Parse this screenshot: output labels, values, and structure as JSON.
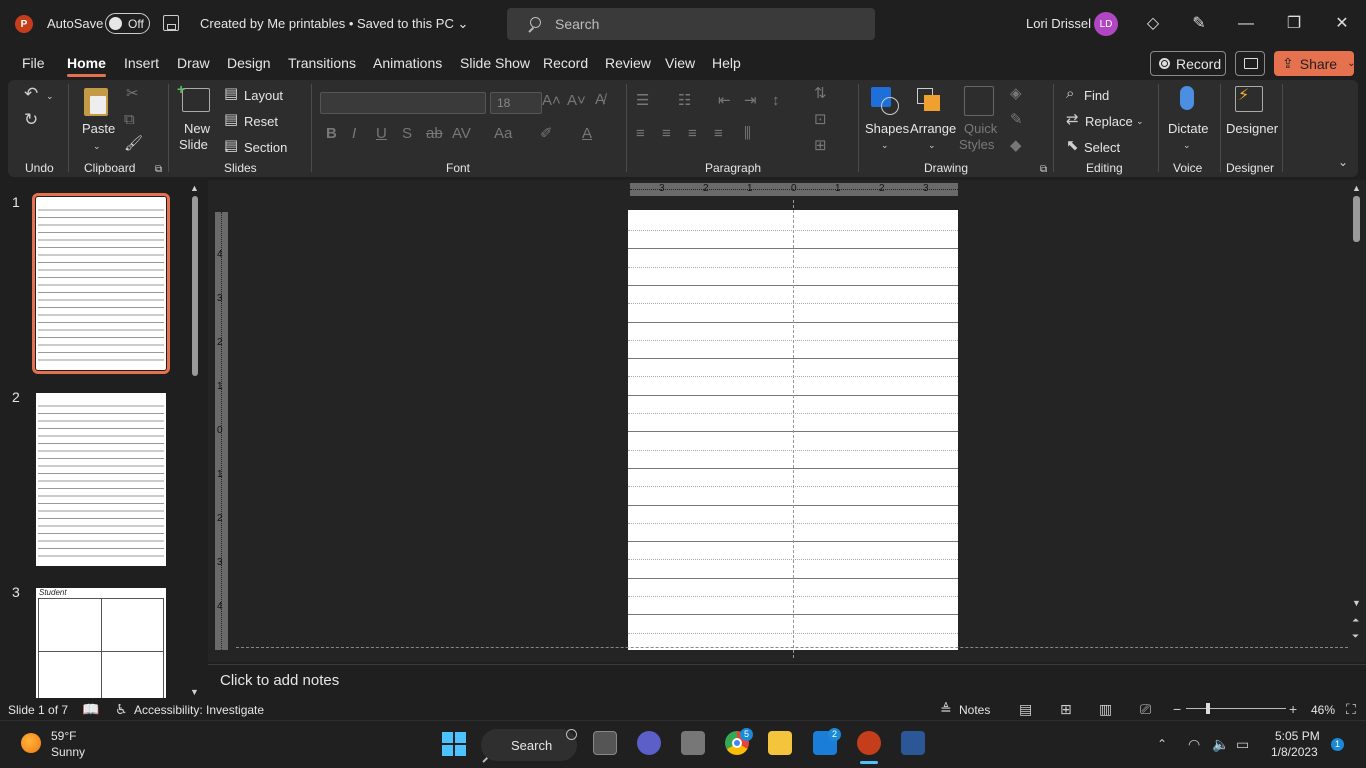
{
  "titlebar": {
    "app_logo_letter": "P",
    "autosave_label": "AutoSave",
    "autosave_state": "Off",
    "document_title": "Created by Me printables • Saved to this PC ⌄",
    "search_placeholder": "Search",
    "user_name": "Lori Drissel",
    "user_initials": "LD"
  },
  "menu": {
    "tabs": [
      "File",
      "Home",
      "Insert",
      "Draw",
      "Design",
      "Transitions",
      "Animations",
      "Slide Show",
      "Record",
      "Review",
      "View",
      "Help"
    ],
    "active_tab": "Home",
    "record_label": "Record",
    "share_label": "Share"
  },
  "ribbon": {
    "groups": {
      "undo": "Undo",
      "clipboard": "Clipboard",
      "slides": "Slides",
      "font": "Font",
      "paragraph": "Paragraph",
      "drawing": "Drawing",
      "editing": "Editing",
      "voice": "Voice",
      "designer": "Designer"
    },
    "paste_label": "Paste",
    "new_slide_label_1": "New",
    "new_slide_label_2": "Slide",
    "layout_label": "Layout",
    "reset_label": "Reset",
    "section_label": "Section",
    "font_size": "18",
    "shapes_label": "Shapes",
    "arrange_label": "Arrange",
    "quick_styles_label_1": "Quick",
    "quick_styles_label_2": "Styles",
    "find_label": "Find",
    "replace_label": "Replace",
    "select_label": "Select",
    "dictate_label": "Dictate",
    "designer_label": "Designer"
  },
  "slides_pane": {
    "slide_numbers": [
      "1",
      "2",
      "3"
    ],
    "thumb3_title": "Student"
  },
  "rulers": {
    "horizontal": [
      "3",
      "2",
      "1",
      "0",
      "1",
      "2",
      "3"
    ],
    "vertical": [
      "4",
      "3",
      "2",
      "1",
      "0",
      "1",
      "2",
      "3",
      "4"
    ]
  },
  "notes": {
    "placeholder": "Click to add notes"
  },
  "status": {
    "slide_counter": "Slide 1 of 7",
    "accessibility": "Accessibility: Investigate",
    "notes_label": "Notes",
    "zoom_level": "46%"
  },
  "taskbar": {
    "temperature": "59°F",
    "condition": "Sunny",
    "search_label": "Search",
    "chrome_badge": "5",
    "mail_badge": "2",
    "time": "5:05 PM",
    "date": "1/8/2023",
    "notification_count": "1"
  }
}
